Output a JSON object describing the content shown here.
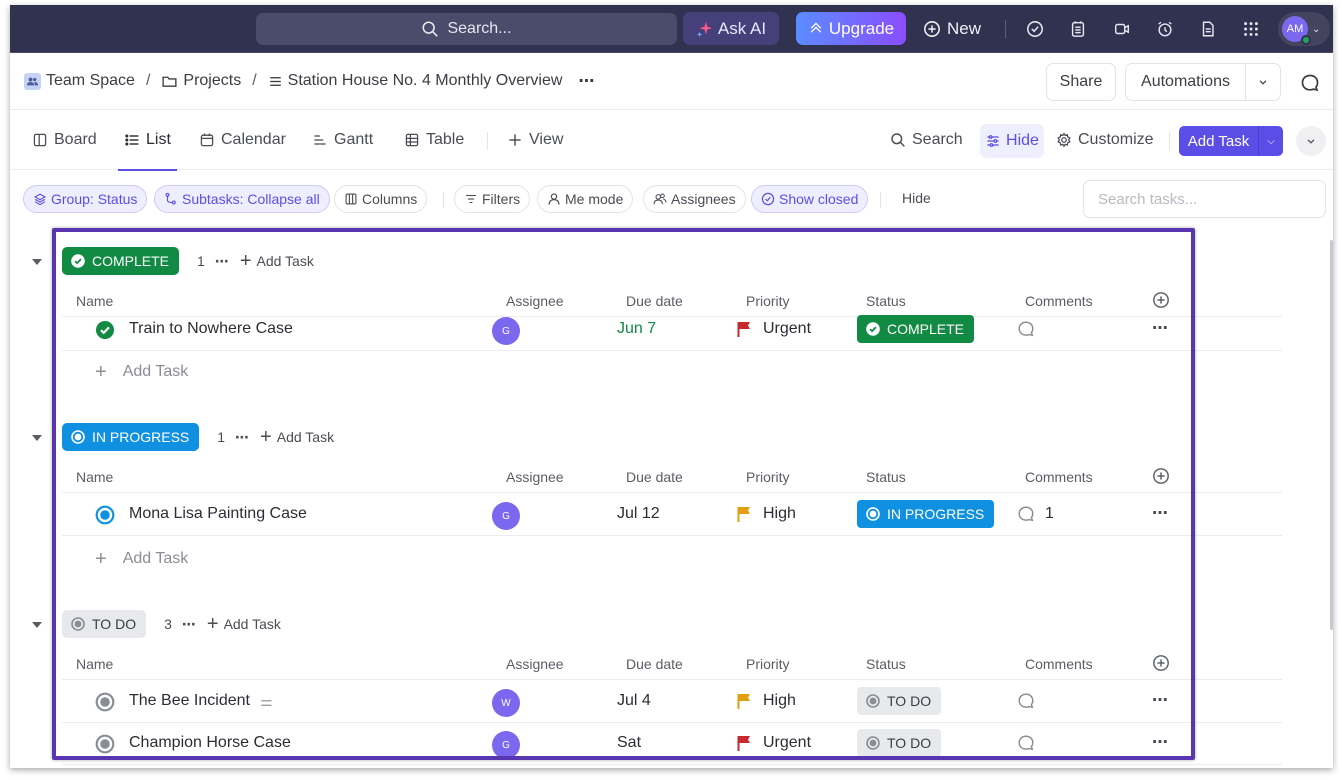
{
  "topbar": {
    "search_placeholder": "Search...",
    "ask_ai_label": "Ask AI",
    "upgrade_label": "Upgrade",
    "new_label": "New",
    "avatar_initials": "AM",
    "icons": [
      "check-circle-icon",
      "notepad-icon",
      "video-icon",
      "alarm-clock-icon",
      "document-icon",
      "apps-grid-icon"
    ]
  },
  "breadcrumb": {
    "items": [
      {
        "label": "Team Space",
        "icon": "team-icon"
      },
      {
        "label": "Projects",
        "icon": "folder-icon"
      },
      {
        "label": "Station House No. 4 Monthly Overview",
        "icon": "list-icon"
      }
    ],
    "separator": "/",
    "more": "⋯"
  },
  "header_actions": {
    "share_label": "Share",
    "automations_label": "Automations"
  },
  "views": {
    "tabs": [
      {
        "label": "Board",
        "icon": "board-icon",
        "active": false
      },
      {
        "label": "List",
        "icon": "list-icon",
        "active": true
      },
      {
        "label": "Calendar",
        "icon": "calendar-icon",
        "active": false
      },
      {
        "label": "Gantt",
        "icon": "gantt-icon",
        "active": false
      },
      {
        "label": "Table",
        "icon": "table-icon",
        "active": false
      }
    ],
    "add_view_label": "View",
    "search_label": "Search",
    "hide_label": "Hide",
    "customize_label": "Customize",
    "add_task_label": "Add Task"
  },
  "filters": {
    "chips": [
      {
        "label": "Group: Status",
        "active": true
      },
      {
        "label": "Subtasks: Collapse all",
        "active": true
      },
      {
        "label": "Columns",
        "active": false
      },
      {
        "label": "Filters",
        "active": false
      },
      {
        "label": "Me mode",
        "active": false
      },
      {
        "label": "Assignees",
        "active": false
      },
      {
        "label": "Show closed",
        "active": true
      }
    ],
    "hide_label": "Hide",
    "search_placeholder": "Search tasks..."
  },
  "columns": {
    "name": "Name",
    "assignee": "Assignee",
    "due_date": "Due date",
    "priority": "Priority",
    "status": "Status",
    "comments": "Comments"
  },
  "add_task_label": "Add Task",
  "colors": {
    "complete": "#118a43",
    "in_progress": "#1090e0",
    "todo": "#e8e9ec",
    "urgent_flag": "#c62a2f",
    "high_flag": "#e0a010",
    "accent": "#5b4ee6",
    "highlight_border": "#5a35b2"
  },
  "groups": [
    {
      "status": "COMPLETE",
      "count": "1",
      "tasks": [
        {
          "name": "Train to Nowhere Case",
          "assignee": "G",
          "due": "Jun 7",
          "priority": "Urgent",
          "status": "COMPLETE",
          "comments": ""
        }
      ]
    },
    {
      "status": "IN PROGRESS",
      "count": "1",
      "tasks": [
        {
          "name": "Mona Lisa Painting Case",
          "assignee": "G",
          "due": "Jul 12",
          "priority": "High",
          "status": "IN PROGRESS",
          "comments": "1"
        }
      ]
    },
    {
      "status": "TO DO",
      "count": "3",
      "tasks": [
        {
          "name": "The Bee Incident",
          "assignee": "W",
          "due": "Jul 4",
          "priority": "High",
          "status": "TO DO",
          "comments": "",
          "has_description": true
        },
        {
          "name": "Champion Horse Case",
          "assignee": "G",
          "due": "Sat",
          "priority": "Urgent",
          "status": "TO DO",
          "comments": ""
        }
      ]
    }
  ]
}
